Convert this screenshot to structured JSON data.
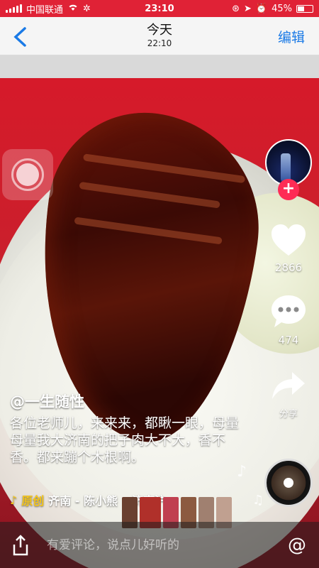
{
  "status": {
    "carrier": "中国联通",
    "time": "23:10",
    "battery": "45%",
    "battery_fraction": 0.45
  },
  "nav": {
    "back": "‹",
    "title": "今天",
    "subtitle": "22:10",
    "edit": "编辑"
  },
  "actions": {
    "likes": "2866",
    "comments": "474",
    "share": "分享",
    "follow": "+"
  },
  "post": {
    "author": "@一生随性",
    "description": "各位老师儿，来来来，都瞅一眼，母量母量我大济南的把子肉大不大，香不香。都来蹦个木根啊。",
    "original_tag": "原创",
    "music": "齐南 - 陈小熊",
    "location": "济南沪"
  },
  "comment": {
    "placeholder": "有爱评论，说点儿好听的",
    "at": "@"
  }
}
